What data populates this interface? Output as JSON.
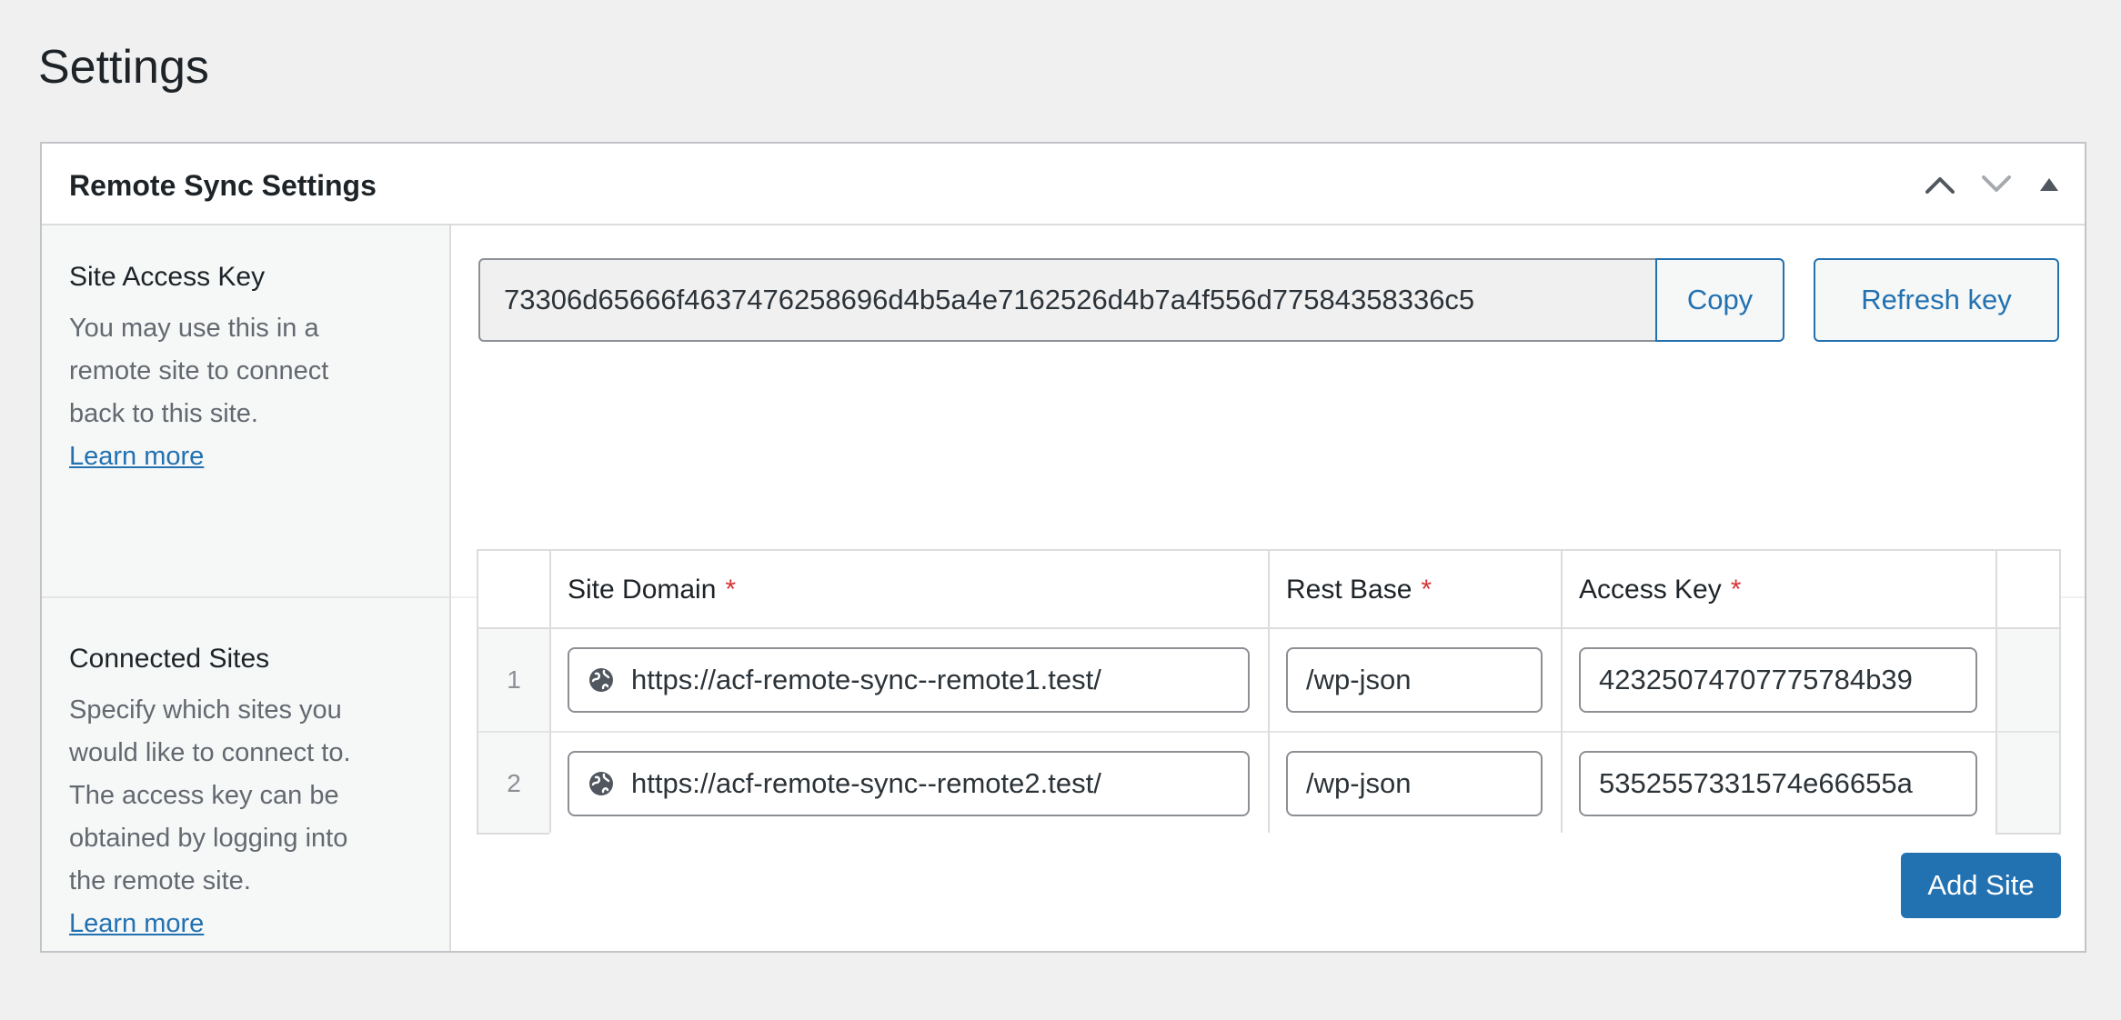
{
  "page": {
    "title": "Settings"
  },
  "panel": {
    "title": "Remote Sync Settings",
    "controls": [
      "chevron-up-icon",
      "chevron-down-icon",
      "triangle-up-icon"
    ]
  },
  "access_key": {
    "label": "Site Access Key",
    "description_lines": [
      "You may use this in a",
      "remote site to connect",
      "back to this site."
    ],
    "learn_more": "Learn more",
    "value": "73306d65666f4637476258696d4b5a4e7162526d4b7a4f556d77584358336c5",
    "copy_label": "Copy",
    "refresh_label": "Refresh key"
  },
  "connected_sites": {
    "label": "Connected Sites",
    "description_lines": [
      "Specify which sites you",
      "would like to connect to.",
      "The access key can be",
      "obtained by logging into",
      "the remote site."
    ],
    "learn_more": "Learn more",
    "columns": [
      {
        "label": "Site Domain",
        "required_mark": "*"
      },
      {
        "label": "Rest Base",
        "required_mark": "*"
      },
      {
        "label": "Access Key",
        "required_mark": "*"
      }
    ],
    "rows": [
      {
        "num": "1",
        "domain": "https://acf-remote-sync--remote1.test/",
        "rest_base": "/wp-json",
        "access_key": "42325074707775784b39"
      },
      {
        "num": "2",
        "domain": "https://acf-remote-sync--remote2.test/",
        "rest_base": "/wp-json",
        "access_key": "5352557331574e66655a"
      }
    ],
    "add_label": "Add Site"
  },
  "colors": {
    "accent": "#2271b1",
    "required": "#d63638",
    "muted": "#646970"
  }
}
